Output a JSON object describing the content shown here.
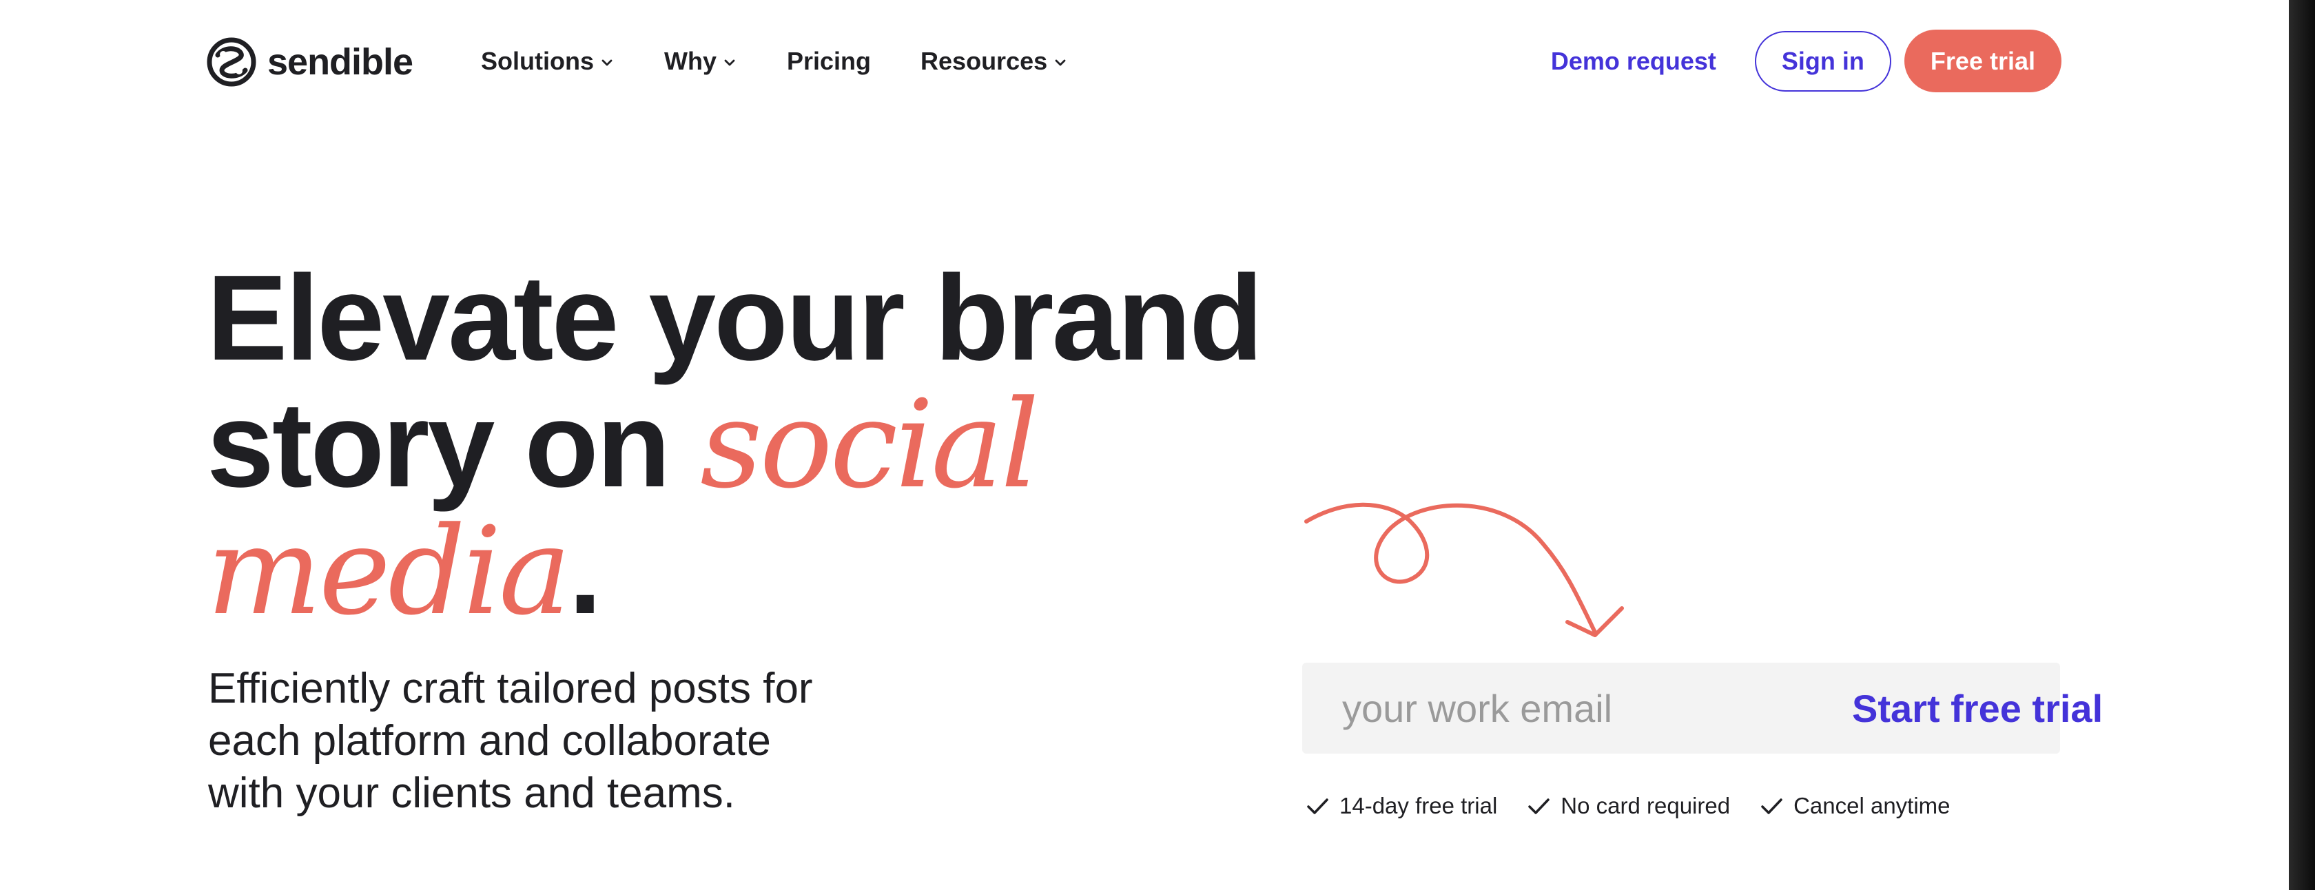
{
  "brand": {
    "name": "sendible",
    "logo_icon": "sendible-logo-icon"
  },
  "nav": {
    "items": [
      {
        "label": "Solutions",
        "has_dropdown": true
      },
      {
        "label": "Why",
        "has_dropdown": true
      },
      {
        "label": "Pricing",
        "has_dropdown": false
      },
      {
        "label": "Resources",
        "has_dropdown": true
      }
    ]
  },
  "header": {
    "demo_label": "Demo request",
    "signin_label": "Sign in",
    "trial_label": "Free trial"
  },
  "hero": {
    "headline_line1": "Elevate your brand",
    "headline_line2_prefix": "story on",
    "headline_accent_1": "social",
    "headline_accent_2": "media",
    "headline_period": ".",
    "subhead": "Efficiently craft tailored posts for each platform and collaborate with your clients and teams."
  },
  "signup": {
    "email_placeholder": "your work email",
    "email_value": "",
    "submit_label": "Start free trial",
    "perks": [
      "14-day free trial",
      "No card required",
      "Cancel anytime"
    ]
  },
  "colors": {
    "primary": "#4433d9",
    "accent": "#ea6a5d",
    "text": "#1f1f23",
    "input_bg": "#f3f3f3",
    "placeholder": "#9a9a9a"
  }
}
